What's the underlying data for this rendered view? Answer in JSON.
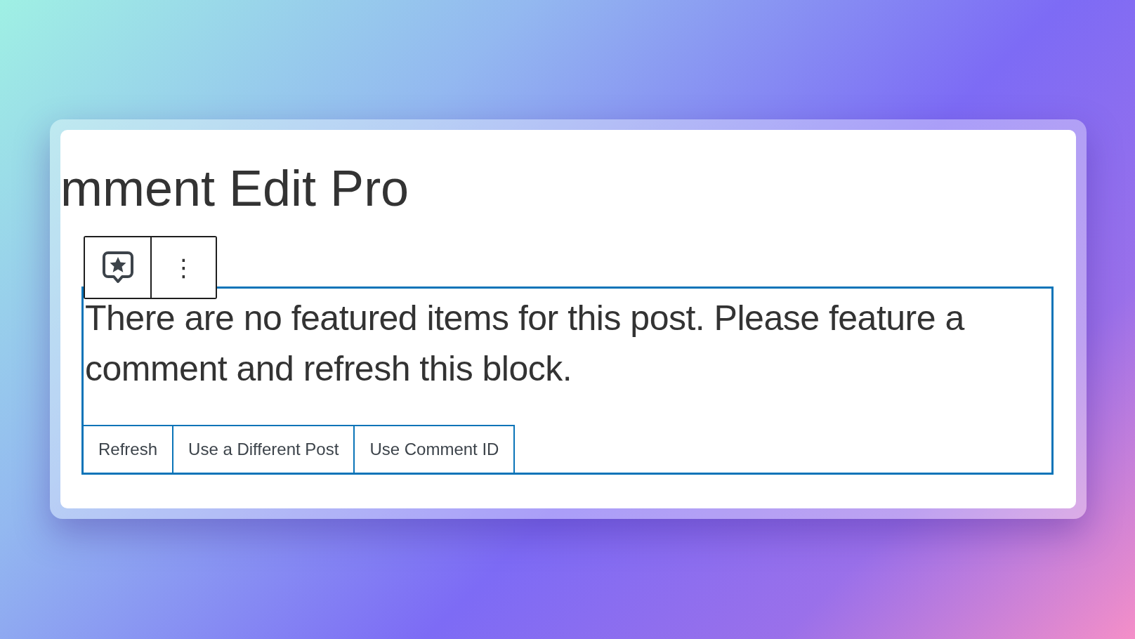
{
  "heading": "mment Edit Pro",
  "block_toolbar": {
    "buttons": [
      {
        "kind": "block-type"
      },
      {
        "kind": "options",
        "label": "⋮"
      }
    ]
  },
  "block": {
    "selected": true,
    "message": "There are no featured items for this post. Please feature a comment and refresh this block.",
    "buttons": [
      "Refresh",
      "Use a Different Post",
      "Use Comment ID"
    ]
  }
}
